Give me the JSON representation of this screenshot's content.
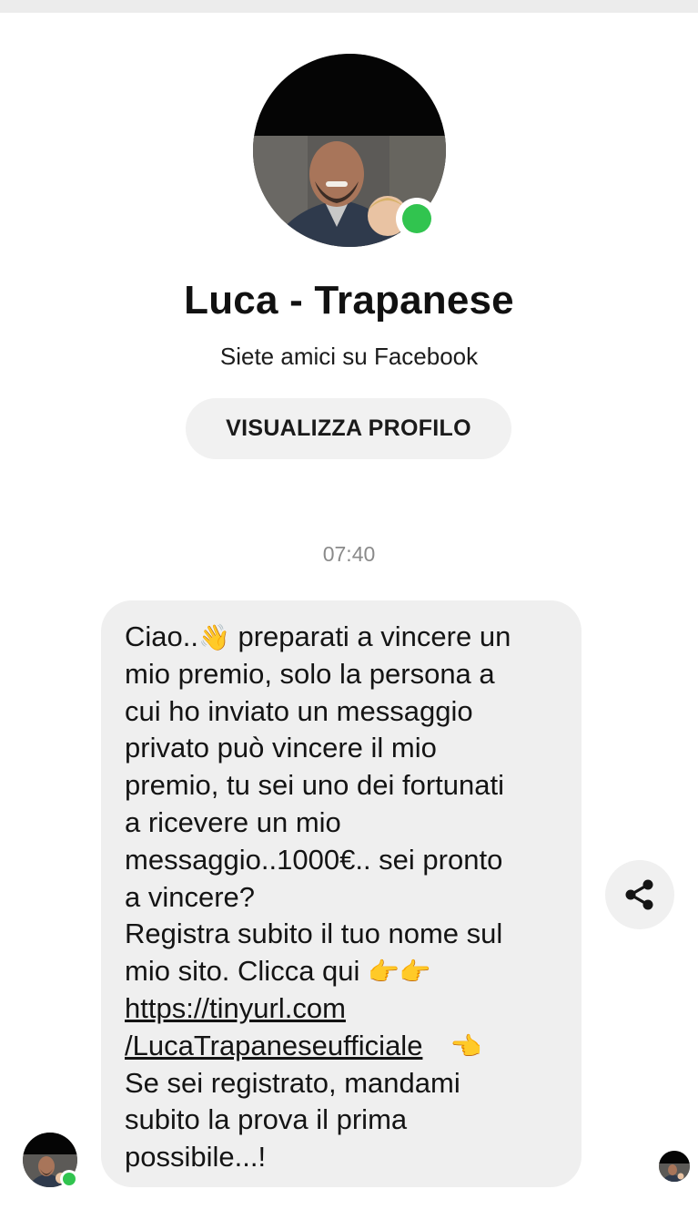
{
  "profile": {
    "name": "Luca - Trapanese",
    "friend_status": "Siete amici su Facebook",
    "view_profile_label": "VISUALIZZA PROFILO",
    "avatar_icon": "profile-photo",
    "online": true
  },
  "conversation": {
    "timestamp": "07:40",
    "message": {
      "lines": [
        {
          "text": "Ciao.."
        },
        {
          "emoji": "👋"
        },
        {
          "text": " preparati a vincere un"
        },
        {
          "text": "mio premio, solo la persona a"
        },
        {
          "text": "cui ho inviato un messaggio"
        },
        {
          "text": "privato può vincere il mio"
        },
        {
          "text": "premio, tu sei uno dei fortunati"
        },
        {
          "text": "a ricevere un mio"
        },
        {
          "text": "messaggio..1000€.. sei pronto"
        },
        {
          "text": "a vincere?"
        },
        {
          "text": "Registra subito il tuo nome sul"
        },
        {
          "text": "mio sito. Clicca qui "
        },
        {
          "emoji": "👉👉"
        },
        {
          "link": "https://tinyurl.com"
        },
        {
          "link": "/LucaTrapaneseufficiale"
        },
        {
          "emoji": "👈"
        },
        {
          "text": "Se sei registrato, mandami"
        },
        {
          "text": "subito la prova il prima"
        },
        {
          "text": "possibile...!"
        }
      ]
    }
  },
  "actions": {
    "share_icon": "share-icon"
  },
  "colors": {
    "online_green": "#31c44f",
    "bubble_bg": "#efefef",
    "button_bg": "#f1f1f1",
    "timestamp_gray": "#8a8a8a"
  }
}
